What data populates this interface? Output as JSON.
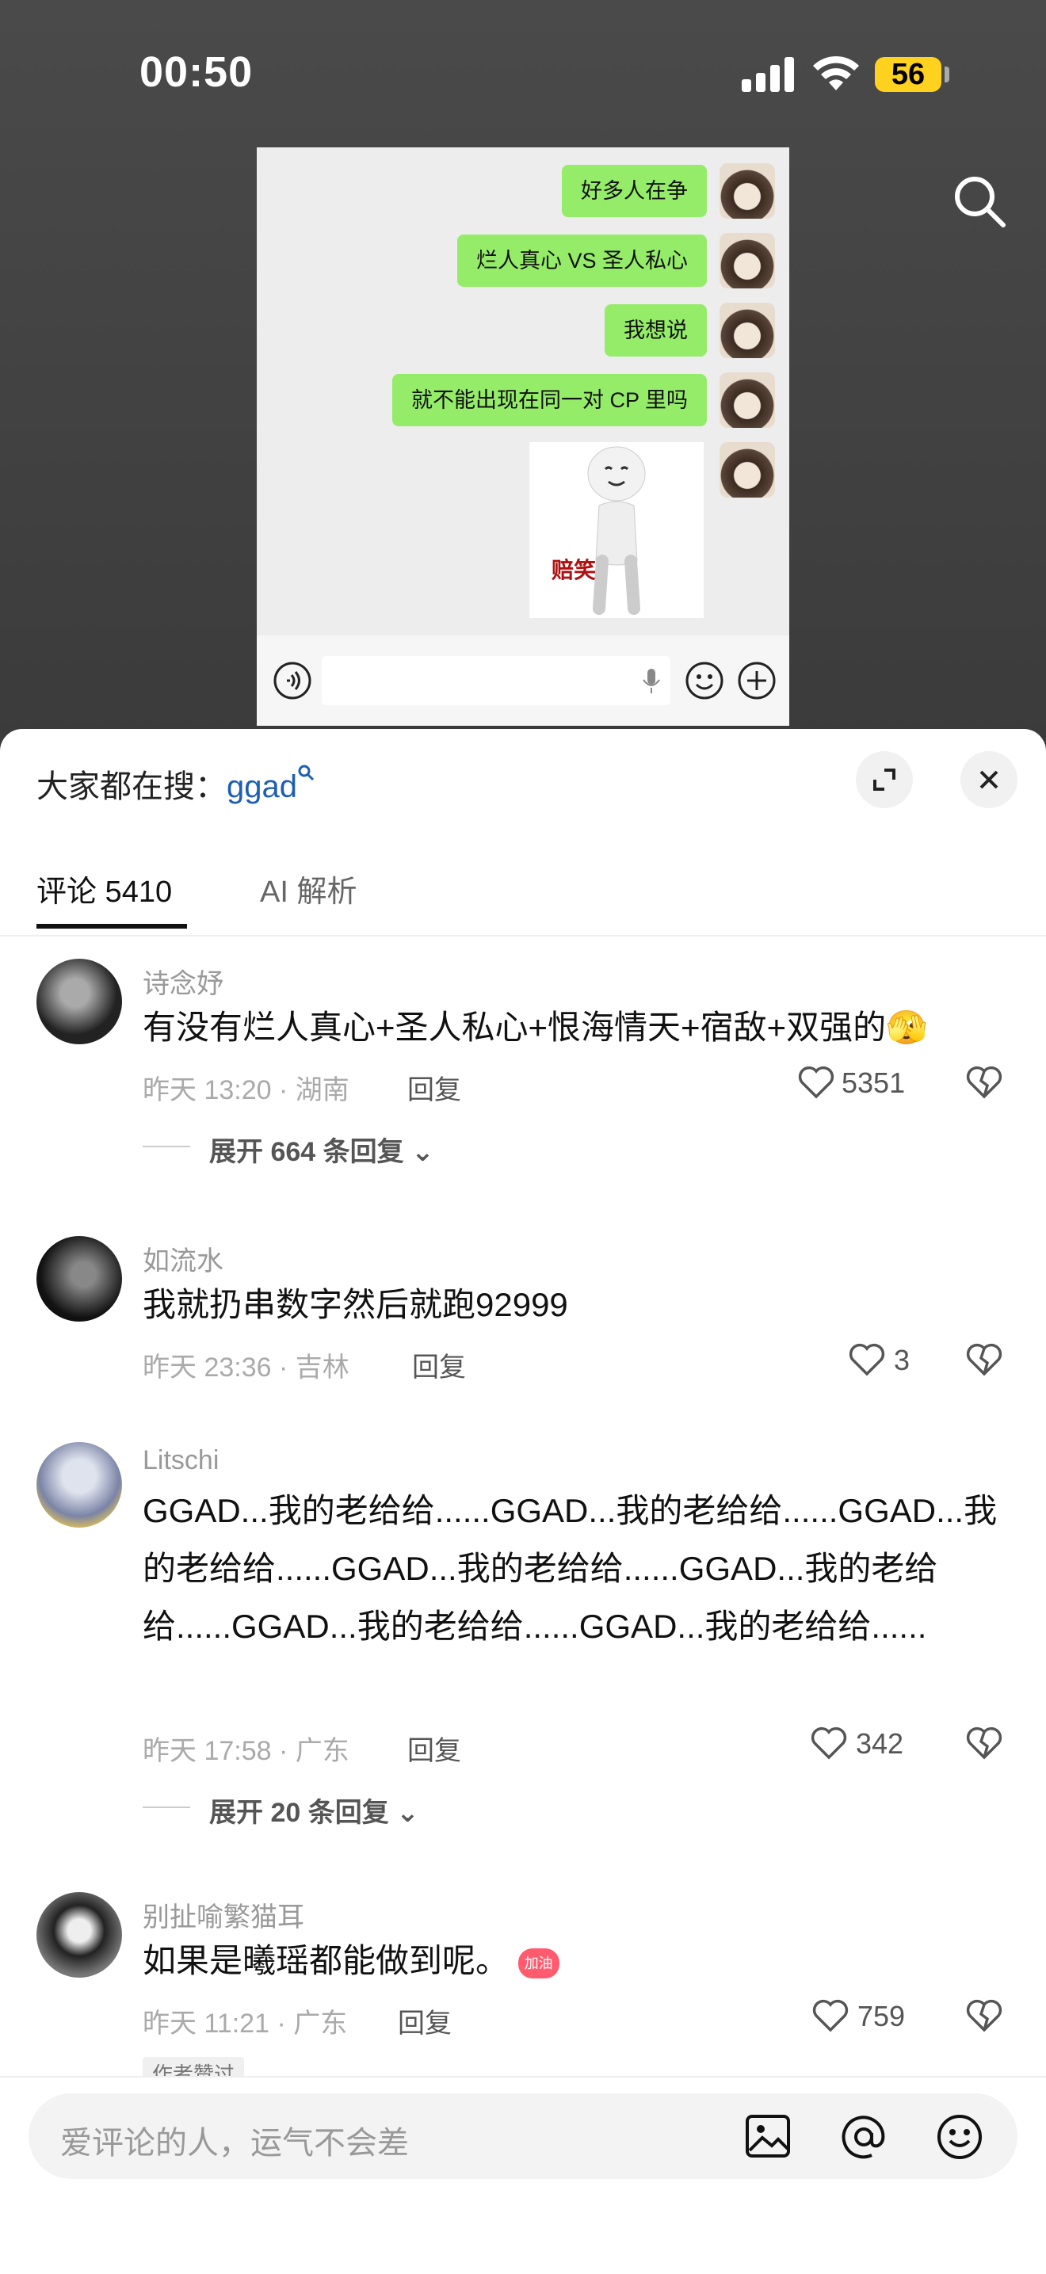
{
  "status_bar": {
    "time": "00:50",
    "battery": "56"
  },
  "video_chat": {
    "messages": [
      "好多人在争",
      "烂人真心 VS 圣人私心",
      "我想说",
      "就不能出现在同一对 CP 里吗"
    ],
    "sticker_text": "赔笑"
  },
  "sheet": {
    "search_prefix": "大家都在搜：",
    "search_keyword": "ggad",
    "tabs": [
      {
        "label": "评论 5410"
      },
      {
        "label": "AI 解析"
      }
    ]
  },
  "comments": [
    {
      "name": "诗念妤",
      "text": "有没有烂人真心+圣人私心+恨海情天+宿敌+双强的🫣",
      "meta": "昨天 13:20 · 湖南",
      "reply": "回复",
      "likes": "5351",
      "expand": "展开 664 条回复"
    },
    {
      "name": "如流水",
      "text": "我就扔串数字然后就跑92999",
      "meta": "昨天 23:36 · 吉林",
      "reply": "回复",
      "likes": "3"
    },
    {
      "name": "Litschi",
      "text": "GGAD...我的老给给......GGAD...我的老给给......GGAD...我的老给给......GGAD...我的老给给......GGAD...我的老给给......GGAD...我的老给给......GGAD...我的老给给......",
      "meta": "昨天 17:58 · 广东",
      "reply": "回复",
      "likes": "342",
      "expand": "展开 20 条回复"
    },
    {
      "name": "别扯喻繁猫耳",
      "text": "如果是曦瑶都能做到呢。",
      "emoji_badge": "加油",
      "meta": "昨天 11:21 · 广东",
      "reply": "回复",
      "likes": "759",
      "author_tag": "作者赞过"
    }
  ],
  "composer": {
    "placeholder": "爱评论的人，运气不会差"
  }
}
